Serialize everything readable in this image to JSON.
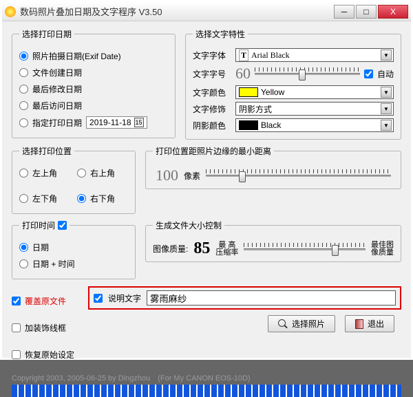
{
  "window": {
    "title": "数码照片叠加日期及文字程序  V3.50",
    "min": "─",
    "max": "□",
    "close": "X"
  },
  "date_group": {
    "legend": "选择打印日期",
    "opt1": "照片拍摄日期(Exif Date)",
    "opt2": "文件创建日期",
    "opt3": "最后修改日期",
    "opt4": "最后访问日期",
    "opt5": "指定打印日期",
    "specified_date": "2019-11-18",
    "cal_num": "15"
  },
  "font_group": {
    "legend": "选择文字特性",
    "font_lbl": "文字字体",
    "font_val": "Arial Black",
    "font_ico": "T",
    "size_lbl": "文字字号",
    "size_val": "60",
    "auto_lbl": "自动",
    "color_lbl": "文字颜色",
    "color_val": "Yellow",
    "color_hex": "#ffff00",
    "deco_lbl": "文字修饰",
    "deco_val": "阴影方式",
    "shadow_lbl": "阴影颜色",
    "shadow_val": "Black",
    "shadow_hex": "#000000"
  },
  "pos_group": {
    "legend": "选择打印位置",
    "tl": "左上角",
    "tr": "右上角",
    "bl": "左下角",
    "br": "右下角"
  },
  "margin_group": {
    "legend": "打印位置距照片边缘的最小距离",
    "value": "100",
    "unit": "像素"
  },
  "time_group": {
    "legend": "打印时间",
    "opt1": "日期",
    "opt2": "日期 + 时间"
  },
  "quality_group": {
    "legend": "生成文件大小控制",
    "lbl": "图像质量:",
    "value": "85",
    "left_top": "最 高",
    "left_bot": "压缩率",
    "right_top": "最佳图",
    "right_bot": "像质量"
  },
  "checks": {
    "overwrite": "覆盖原文件",
    "border": "加装饰线框",
    "restore": "恢复原始设定",
    "desc_lbl": "说明文字",
    "desc_val": "雾雨麻纱"
  },
  "buttons": {
    "select": "选择照片",
    "exit": "退出"
  },
  "footer": "Copyright 2003, 2005-06-25 by Dingzhou　(For My CANON EOS-10D)"
}
